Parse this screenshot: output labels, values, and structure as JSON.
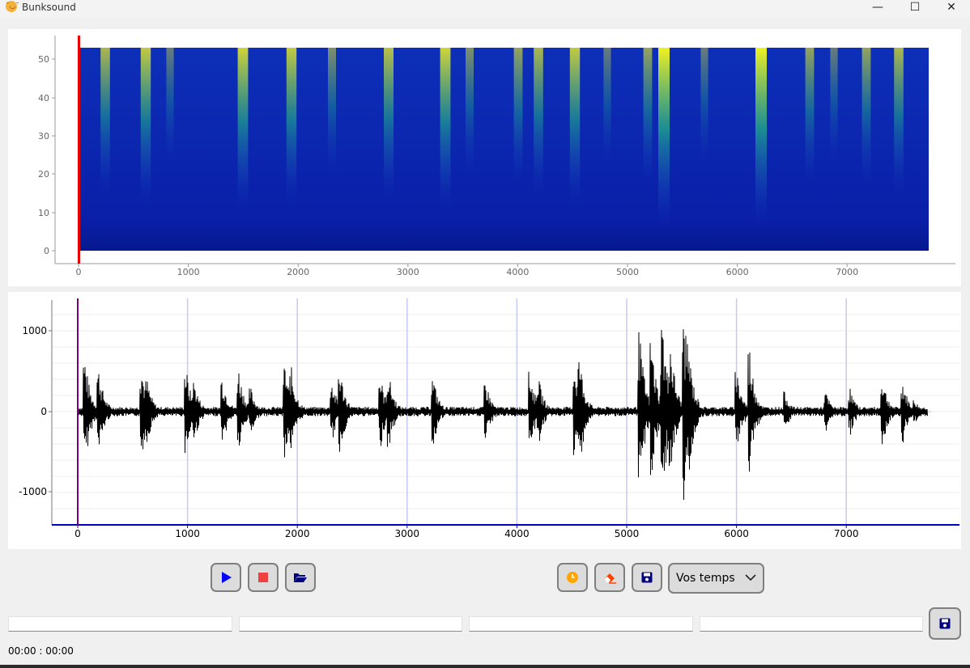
{
  "window": {
    "title": "Bunksound",
    "icon": "smiley-icon",
    "controls": {
      "minimize": "—",
      "maximize": "☐",
      "close": "✕"
    }
  },
  "spectrogram": {
    "y_ticks": [
      "50",
      "40",
      "30",
      "20",
      "10",
      "0"
    ],
    "x_ticks": [
      "0",
      "1000",
      "2000",
      "3000",
      "4000",
      "5000",
      "6000",
      "7000"
    ],
    "colors": {
      "low": "#0a1fa8",
      "mid": "#1fae8a",
      "high": "#f1f221",
      "cursor": "#e60000"
    }
  },
  "waveform": {
    "y_ticks": [
      "1000",
      "0",
      "-1000"
    ],
    "x_ticks": [
      "0",
      "1000",
      "2000",
      "3000",
      "4000",
      "5000",
      "6000",
      "7000"
    ],
    "colors": {
      "wave": "#000000",
      "cursor": "#7a0080",
      "axis": "#0000c0",
      "marker": "#c8c8f0"
    }
  },
  "controls": {
    "play": {
      "icon": "play-icon",
      "color": "#0000ff"
    },
    "stop": {
      "icon": "stop-icon",
      "color": "#f04040"
    },
    "open": {
      "icon": "folder-open-icon",
      "color": "#000080"
    },
    "timer": {
      "icon": "clock-icon",
      "color": "#ffa500"
    },
    "erase": {
      "icon": "eraser-icon",
      "color": "#ff4000"
    },
    "save": {
      "icon": "save-icon",
      "color": "#000080"
    },
    "dropdown": {
      "selected": "Vos temps"
    },
    "save_fields": {
      "icon": "save-icon"
    }
  },
  "fields": [
    "",
    "",
    "",
    ""
  ],
  "timer_text": "00:00 : 00:00"
}
